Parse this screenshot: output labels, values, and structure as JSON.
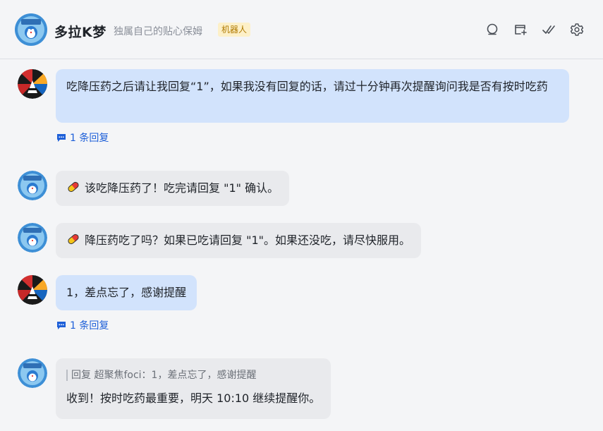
{
  "header": {
    "title": "多拉K梦",
    "subtitle": "独属自己的贴心保姆",
    "badge": "机器人",
    "icons": [
      "search-icon",
      "add-panel-icon",
      "check-icon",
      "gear-icon"
    ]
  },
  "messages": [
    {
      "sender": "user",
      "text": "吃降压药之后请让我回复“1”，如果我没有回复的话，请过十分钟再次提醒询问我是否有按时吃药",
      "reply_count": "1 条回复"
    },
    {
      "sender": "bot",
      "icon": "pill-icon",
      "text": "该吃降压药了！吃完请回复 \"1\" 确认。"
    },
    {
      "sender": "bot",
      "icon": "pill-icon",
      "text": "降压药吃了吗？如果已吃请回复 \"1\"。如果还没吃，请尽快服用。"
    },
    {
      "sender": "user",
      "text": "1，差点忘了，感谢提醒",
      "reply_count": "1 条回复"
    },
    {
      "sender": "bot",
      "quote": "回复 超聚焦foci：1，差点忘了，感谢提醒",
      "text": "收到！按时吃药最重要，明天 10:10 继续提醒你。"
    }
  ],
  "colors": {
    "user_bubble": "#d2e3fc",
    "bot_bubble": "#e9eaed",
    "link": "#1d5fd8",
    "badge_bg": "#fdf0c8"
  }
}
